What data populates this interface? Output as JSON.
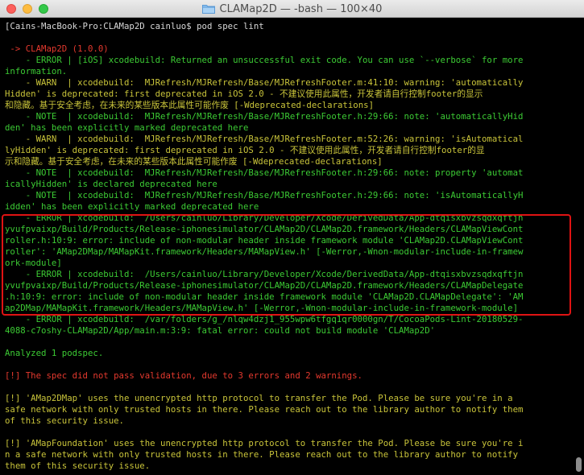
{
  "window": {
    "title": "CLAMap2D — -bash — 100×40"
  },
  "terminal": {
    "lines": [
      {
        "text": "[Cains-MacBook-Pro:CLAMap2D cainluo$ pod spec lint",
        "color": "white"
      },
      {
        "text": "",
        "color": "white"
      },
      {
        "text": " -> CLAMap2D (1.0.0)",
        "color": "red"
      },
      {
        "text": "    - ERROR | [iOS] xcodebuild: Returned an unsuccessful exit code. You can use `--verbose` for more",
        "color": "green"
      },
      {
        "text": "information.",
        "color": "green"
      },
      {
        "text": "    - WARN  | xcodebuild:  MJRefresh/MJRefresh/Base/MJRefreshFooter.m:41:10: warning: 'automatically",
        "color": "yellow"
      },
      {
        "text": "Hidden' is deprecated: first deprecated in iOS 2.0 - 不建议使用此属性，开发者请自行控制footer的显示",
        "color": "yellow"
      },
      {
        "text": "和隐藏。基于安全考虑，在未来的某些版本此属性可能作废 [-Wdeprecated-declarations]",
        "color": "yellow"
      },
      {
        "text": "    - NOTE  | xcodebuild:  MJRefresh/MJRefresh/Base/MJRefreshFooter.h:29:66: note: 'automaticallyHid",
        "color": "green"
      },
      {
        "text": "den' has been explicitly marked deprecated here",
        "color": "green"
      },
      {
        "text": "    - WARN  | xcodebuild:  MJRefresh/MJRefresh/Base/MJRefreshFooter.m:52:26: warning: 'isAutomatical",
        "color": "yellow"
      },
      {
        "text": "lyHidden' is deprecated: first deprecated in iOS 2.0 - 不建议使用此属性，开发者请自行控制footer的显",
        "color": "yellow"
      },
      {
        "text": "示和隐藏。基于安全考虑，在未来的某些版本此属性可能作废 [-Wdeprecated-declarations]",
        "color": "yellow"
      },
      {
        "text": "    - NOTE  | xcodebuild:  MJRefresh/MJRefresh/Base/MJRefreshFooter.h:29:66: note: property 'automat",
        "color": "green"
      },
      {
        "text": "icallyHidden' is declared deprecated here",
        "color": "green"
      },
      {
        "text": "    - NOTE  | xcodebuild:  MJRefresh/MJRefresh/Base/MJRefreshFooter.h:29:66: note: 'isAutomaticallyH",
        "color": "green"
      },
      {
        "text": "idden' has been explicitly marked deprecated here",
        "color": "green"
      },
      {
        "text": "    - ERROR | xcodebuild:  /Users/cainluo/Library/Developer/Xcode/DerivedData/App-dtqisxbvzsqdxqftjn",
        "color": "green"
      },
      {
        "text": "yvufpvaixp/Build/Products/Release-iphonesimulator/CLAMap2D/CLAMap2D.framework/Headers/CLAMapViewCont",
        "color": "green"
      },
      {
        "text": "roller.h:10:9: error: include of non-modular header inside framework module 'CLAMap2D.CLAMapViewCont",
        "color": "green"
      },
      {
        "text": "roller': 'AMap2DMap/MAMapKit.framework/Headers/MAMapView.h' [-Werror,-Wnon-modular-include-in-framew",
        "color": "green"
      },
      {
        "text": "ork-module]",
        "color": "green"
      },
      {
        "text": "    - ERROR | xcodebuild:  /Users/cainluo/Library/Developer/Xcode/DerivedData/App-dtqisxbvzsqdxqftjn",
        "color": "green"
      },
      {
        "text": "yvufpvaixp/Build/Products/Release-iphonesimulator/CLAMap2D/CLAMap2D.framework/Headers/CLAMapDelegate",
        "color": "green"
      },
      {
        "text": ".h:10:9: error: include of non-modular header inside framework module 'CLAMap2D.CLAMapDelegate': 'AM",
        "color": "green"
      },
      {
        "text": "ap2DMap/MAMapKit.framework/Headers/MAMapView.h' [-Werror,-Wnon-modular-include-in-framework-module]",
        "color": "green"
      },
      {
        "text": "    - ERROR | xcodebuild:  /var/folders/g_/nlqw4dzj1_955wpw6tfgq1qr0000gn/T/CocoaPods-Lint-20180529-",
        "color": "green"
      },
      {
        "text": "4088-c7oshy-CLAMap2D/App/main.m:3:9: fatal error: could not build module 'CLAMap2D'",
        "color": "green"
      },
      {
        "text": "",
        "color": "white"
      },
      {
        "text": "Analyzed 1 podspec.",
        "color": "green"
      },
      {
        "text": "",
        "color": "white"
      },
      {
        "text": "[!] The spec did not pass validation, due to 3 errors and 2 warnings.",
        "color": "red"
      },
      {
        "text": "",
        "color": "white"
      },
      {
        "text": "[!] 'AMap2DMap' uses the unencrypted http protocol to transfer the Pod. Please be sure you're in a",
        "color": "yellow"
      },
      {
        "text": "safe network with only trusted hosts in there. Please reach out to the library author to notify them",
        "color": "yellow"
      },
      {
        "text": "of this security issue.",
        "color": "yellow"
      },
      {
        "text": "",
        "color": "white"
      },
      {
        "text": "[!] 'AMapFoundation' uses the unencrypted http protocol to transfer the Pod. Please be sure you're i",
        "color": "yellow"
      },
      {
        "text": "n a safe network with only trusted hosts in there. Please reach out to the library author to notify",
        "color": "yellow"
      },
      {
        "text": "them of this security issue.",
        "color": "yellow"
      }
    ]
  }
}
